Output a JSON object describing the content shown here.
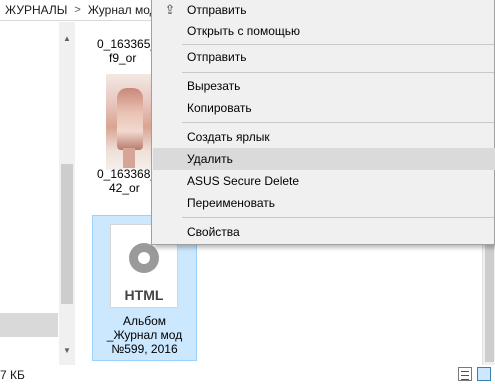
{
  "address_bar": {
    "crumb_1": "ЖУРНАЛЫ",
    "separator": ">",
    "crumb_2": "Журнал мод"
  },
  "nav_arrows": {
    "up": "▲",
    "down": "▼"
  },
  "files": {
    "item_1_line_1": "0_163365_",
    "item_1_line_2": "f9_or",
    "item_2_line_1": "0_163368_",
    "item_2_line_2": "42_or",
    "selected_icon_text": "HTML",
    "selected_line_1": "Альбом",
    "selected_line_2": "_Журнал мод",
    "selected_line_3": "№599, 2016"
  },
  "context_menu": {
    "share_icon": "share-icon",
    "share_icon_glyph": "⇪",
    "items": [
      {
        "label": "Отправить"
      },
      {
        "label": "Открыть с помощью"
      },
      {
        "label": "Отправить"
      },
      {
        "label": "Вырезать"
      },
      {
        "label": "Копировать"
      },
      {
        "label": "Создать ярлык"
      },
      {
        "label": "Удалить"
      },
      {
        "label": "ASUS Secure Delete"
      },
      {
        "label": "Переименовать"
      },
      {
        "label": "Свойства"
      }
    ],
    "hovered_item": "Удалить"
  },
  "status_bar": {
    "size_text": "7 КБ"
  },
  "colors": {
    "selection_fill": "#cce8ff",
    "selection_border": "#99d1ff",
    "menu_background": "#f0f0f0",
    "menu_hover": "#dadada"
  }
}
